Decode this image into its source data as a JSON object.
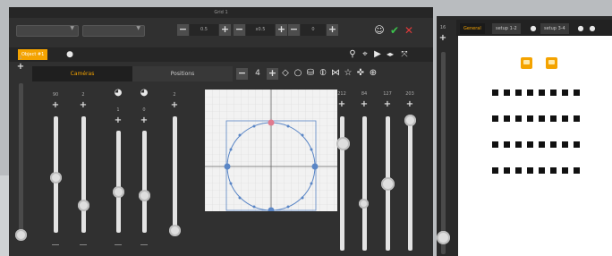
{
  "window": {
    "title": "Grid 1"
  },
  "toolbar": {
    "combo1": "",
    "combo2": "",
    "steppers": [
      {
        "value": "0.5"
      },
      {
        "value": "x0.5"
      },
      {
        "value": "0"
      }
    ]
  },
  "object_tab": {
    "label": "Object #1"
  },
  "mode_tabs": [
    {
      "label": "Caméras"
    },
    {
      "label": "Positions"
    }
  ],
  "shape_count": "4",
  "left_faders": [
    {
      "label": "90",
      "level": 0.48
    },
    {
      "label": "2",
      "level": 0.22
    },
    {
      "label": "1",
      "level": 0.34
    },
    {
      "label": "0",
      "level": 0.32
    },
    {
      "label": "2",
      "level": 0.05
    }
  ],
  "right_faders": [
    {
      "label": "212",
      "level": 0.84
    },
    {
      "label": "84",
      "level": 0.36
    },
    {
      "label": "127",
      "level": 0.5
    },
    {
      "label": "203",
      "level": 0.96
    }
  ],
  "master_left": {
    "label": "1",
    "level": 0.06
  },
  "master_right": {
    "label": "16",
    "level": 0.08
  },
  "right_tabs": [
    {
      "label": "General"
    },
    {
      "label": "setup 1-2"
    },
    {
      "label": "setup 3-4"
    }
  ],
  "colors": {
    "accent": "#f4a300",
    "bg": "#303030",
    "panel_bg": "#f2f2f2",
    "circle": "#5a86c6",
    "ok": "#3cc24d",
    "close": "#e03a3a"
  },
  "icons": [
    "search-icon",
    "zoom-icon",
    "play-icon",
    "fit-icon",
    "expand-icon",
    "settings-icon",
    "check-icon",
    "close-icon"
  ]
}
